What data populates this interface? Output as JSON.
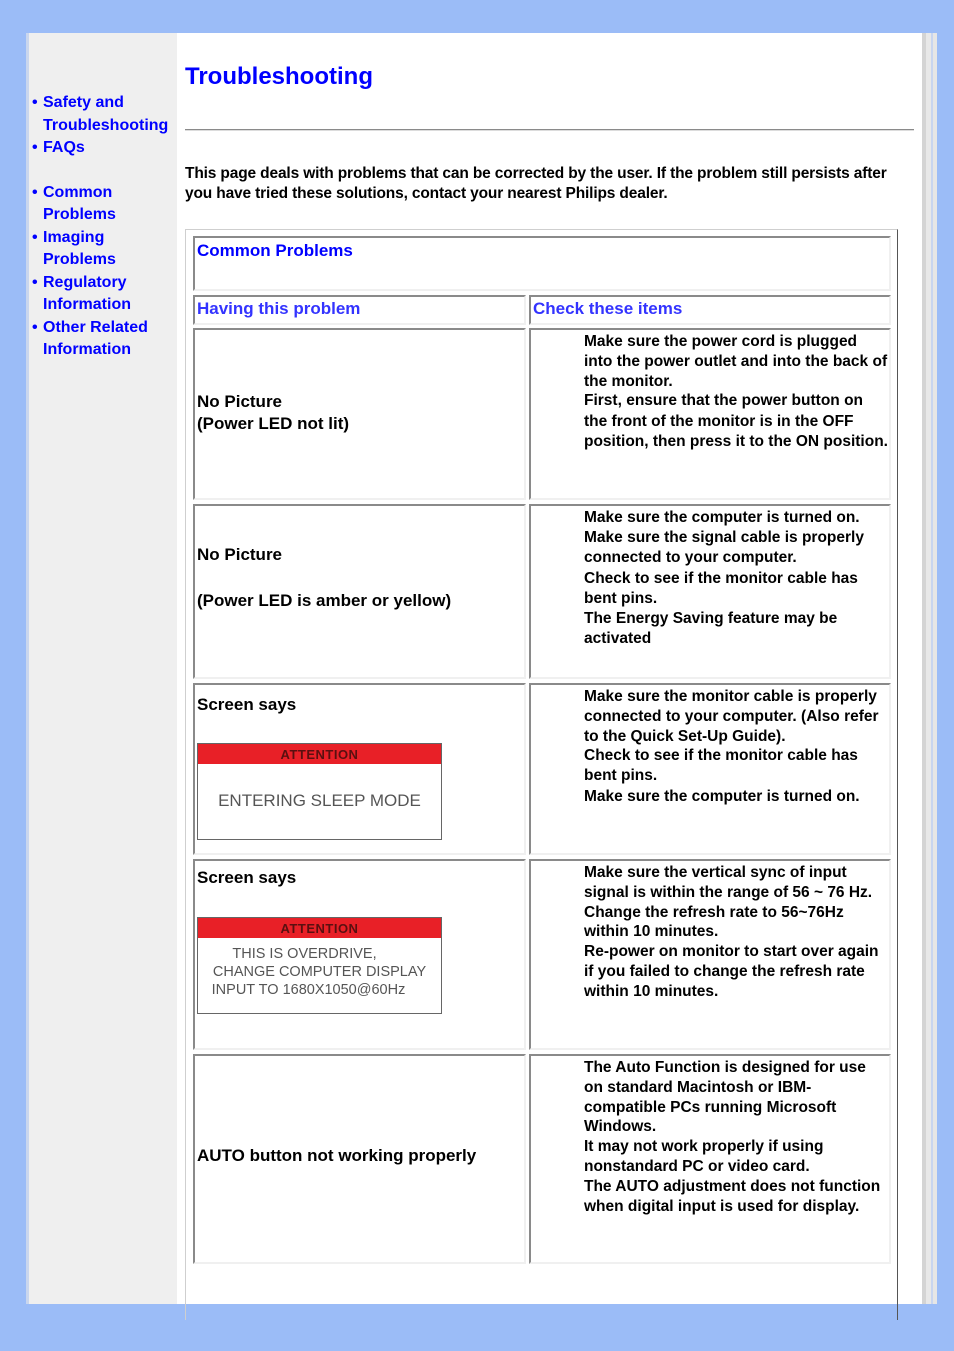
{
  "sidebar": {
    "items": [
      {
        "label": "Safety and Troubleshooting"
      },
      {
        "label": "FAQs"
      },
      {
        "label": "Common Problems"
      },
      {
        "label": "Imaging Problems"
      },
      {
        "label": "Regulatory Information"
      },
      {
        "label": "Other Related Information"
      }
    ],
    "bullet": "•"
  },
  "page": {
    "title": "Troubleshooting",
    "intro": "This page deals with problems that can be corrected by the user. If the problem still persists after you have tried these solutions, contact your nearest Philips dealer."
  },
  "table": {
    "heading": "Common Problems",
    "col_problem": "Having this problem",
    "col_check": "Check these items",
    "rows": [
      {
        "problem": [
          "No Picture",
          "(Power LED not lit)"
        ],
        "checks": [
          "Make sure the power cord is plugged into the power outlet and into the back of the monitor.",
          "First, ensure that the power button on the front of the monitor is in the OFF position, then press it to the ON position."
        ]
      },
      {
        "problem": [
          "No Picture",
          "(Power LED is amber or yellow)"
        ],
        "checks": [
          "Make sure the computer is turned on.",
          "Make sure the signal cable is properly connected to your computer.",
          "Check to see if the monitor cable has bent pins.",
          "The Energy Saving feature may be activated"
        ]
      },
      {
        "problem": [
          "Screen says"
        ],
        "osd": {
          "header": "ATTENTION",
          "lines": [
            "ENTERING SLEEP MODE"
          ]
        },
        "checks": [
          "Make sure the monitor cable is properly connected to your computer. (Also refer to the Quick Set-Up Guide).",
          "Check to see if the monitor cable has bent pins.",
          "Make sure the computer is turned on."
        ]
      },
      {
        "problem": [
          "Screen says"
        ],
        "osd": {
          "header": "ATTENTION",
          "lines": [
            "THIS IS OVERDRIVE,",
            "CHANGE COMPUTER DISPLAY",
            "INPUT TO 1680X1050@60Hz"
          ]
        },
        "checks": [
          "Make sure the vertical sync of input signal is within the range of 56 ~ 76 Hz.",
          "Change the refresh rate to 56~76Hz within 10 minutes.",
          "Re-power on monitor to start over again if you failed to change the refresh rate within 10 minutes."
        ]
      },
      {
        "problem": [
          "AUTO button not working properly"
        ],
        "checks": [
          "The Auto Function is designed for use on standard Macintosh or IBM-compatible PCs running Microsoft Windows.",
          "It may not work properly if using nonstandard PC or video card.",
          "The AUTO adjustment does not function when digital input is used for display."
        ]
      }
    ]
  },
  "colors": {
    "link": "#0000ff",
    "page_background": "#9bbcf7",
    "sidebar_background": "#efefef",
    "osd_header": "#e82027"
  }
}
